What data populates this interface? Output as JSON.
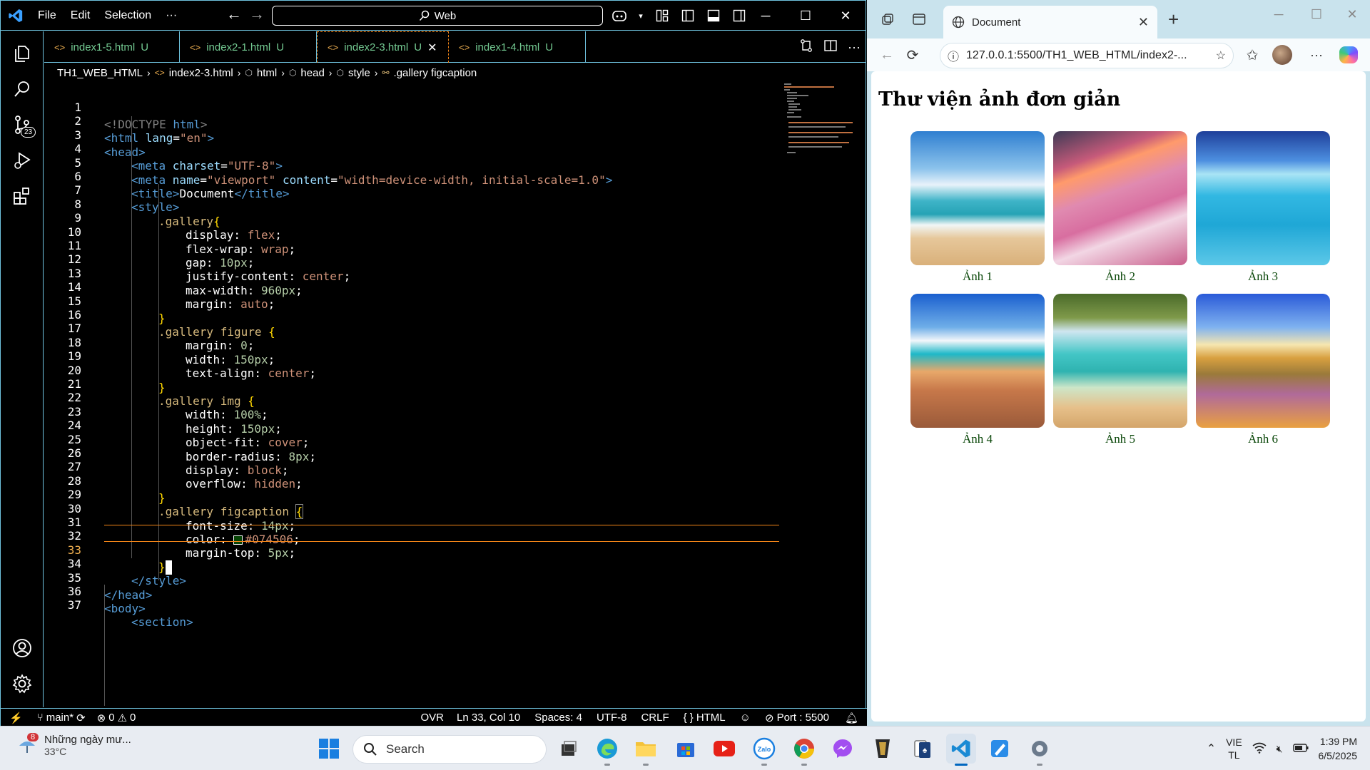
{
  "vscode": {
    "menu": [
      "File",
      "Edit",
      "Selection",
      "···"
    ],
    "command_center": "Web",
    "tabs": [
      {
        "label": "index1-5.html",
        "status": "U",
        "active": false
      },
      {
        "label": "index2-1.html",
        "status": "U",
        "active": false
      },
      {
        "label": "index2-3.html",
        "status": "U",
        "active": true
      },
      {
        "label": "index1-4.html",
        "status": "U",
        "active": false
      }
    ],
    "breadcrumb": [
      "TH1_WEB_HTML",
      "index2-3.html",
      "html",
      "head",
      "style",
      ".gallery figcaption"
    ],
    "scm_badge": "23",
    "status": {
      "branch": "main*",
      "errors": "0",
      "warnings": "0",
      "ovr": "OVR",
      "position": "Ln 33, Col 10",
      "spaces": "Spaces: 4",
      "encoding": "UTF-8",
      "eol": "CRLF",
      "language": "HTML",
      "port": "Port : 5500"
    },
    "current_line": 33,
    "line_numbers": [
      "1",
      "2",
      "3",
      "4",
      "5",
      "6",
      "7",
      "8",
      "9",
      "10",
      "11",
      "12",
      "13",
      "14",
      "15",
      "16",
      "17",
      "18",
      "19",
      "20",
      "21",
      "22",
      "23",
      "24",
      "25",
      "26",
      "27",
      "28",
      "29",
      "30",
      "31",
      "32",
      "33",
      "34",
      "35",
      "36",
      "37"
    ],
    "code": {
      "l1_doctype": "<!DOCTYPE ",
      "l1_html": "html",
      "l1_close": ">",
      "l2_open": "<html ",
      "l2_attr": "lang",
      "l2_eq": "=",
      "l2_val": "\"en\"",
      "l2_close": ">",
      "l3": "<head>",
      "l4_tag": "<meta ",
      "l4_attr": "charset",
      "l4_val": "\"UTF-8\"",
      "l4_close": ">",
      "l5_tag": "<meta ",
      "l5_attr1": "name",
      "l5_val1": "\"viewport\"",
      "l5_attr2": "content",
      "l5_val2": "\"width=device-width, initial-scale=1.0\"",
      "l5_close": ">",
      "l6_open": "<title>",
      "l6_text": "Document",
      "l6_close": "</title>",
      "l7": "<style>",
      "l8_sel": ".gallery",
      "l8_brace": "{",
      "l9_prop": "display: ",
      "l9_val": "flex",
      "l9_end": ";",
      "l10_prop": "flex-wrap: ",
      "l10_val": "wrap",
      "l10_end": ";",
      "l11_prop": "gap: ",
      "l11_val": "10px",
      "l11_end": ";",
      "l12_prop": "justify-content: ",
      "l12_val": "center",
      "l12_end": ";",
      "l13_prop": "max-width: ",
      "l13_val": "960px",
      "l13_end": ";",
      "l14_prop": "margin: ",
      "l14_val": "auto",
      "l14_end": ";",
      "l15": "}",
      "l16_sel": ".gallery figure ",
      "l16_brace": "{",
      "l17_prop": "margin: ",
      "l17_val": "0",
      "l17_end": ";",
      "l18_prop": "width: ",
      "l18_val": "150px",
      "l18_end": ";",
      "l19_prop": "text-align: ",
      "l19_val": "center",
      "l19_end": ";",
      "l20": "}",
      "l21_sel": ".gallery img ",
      "l21_brace": "{",
      "l22_prop": "width: ",
      "l22_val": "100%",
      "l22_end": ";",
      "l23_prop": "height: ",
      "l23_val": "150px",
      "l23_end": ";",
      "l24_prop": "object-fit: ",
      "l24_val": "cover",
      "l24_end": ";",
      "l25_prop": "border-radius: ",
      "l25_val": "8px",
      "l25_end": ";",
      "l26_prop": "display: ",
      "l26_val": "block",
      "l26_end": ";",
      "l27_prop": "overflow: ",
      "l27_val": "hidden",
      "l27_end": ";",
      "l28": "}",
      "l29_sel": ".gallery figcaption ",
      "l29_brace": "{",
      "l30_prop": "font-size: ",
      "l30_val": "14px",
      "l30_end": ";",
      "l31_prop": "color: ",
      "l31_val": "#074506",
      "l31_end": ";",
      "l32_prop": "margin-top: ",
      "l32_val": "5px",
      "l32_end": ";",
      "l33": "}",
      "l34": "</style>",
      "l35": "</head>",
      "l36": "<body>",
      "l37": "<section>"
    }
  },
  "edge": {
    "tab_title": "Document",
    "url": "127.0.0.1:5500/TH1_WEB_HTML/index2-...",
    "page_title": "Thư viện ảnh đơn giản",
    "figures": [
      {
        "caption": "Ảnh 1"
      },
      {
        "caption": "Ảnh 2"
      },
      {
        "caption": "Ảnh 3"
      },
      {
        "caption": "Ảnh 4"
      },
      {
        "caption": "Ảnh 5"
      },
      {
        "caption": "Ảnh 6"
      }
    ]
  },
  "taskbar": {
    "weather_badge": "8",
    "weather_title": "Những ngày mư...",
    "weather_temp": "33°C",
    "search_placeholder": "Search",
    "lang_line1": "VIE",
    "lang_line2": "TL",
    "time": "1:39 PM",
    "date": "6/5/2025"
  },
  "colors": {
    "hc_border": "#6fc3df",
    "active_tab_border": "#f38518",
    "caption_color": "#074506",
    "browser_frame": "#c9e3ed"
  }
}
